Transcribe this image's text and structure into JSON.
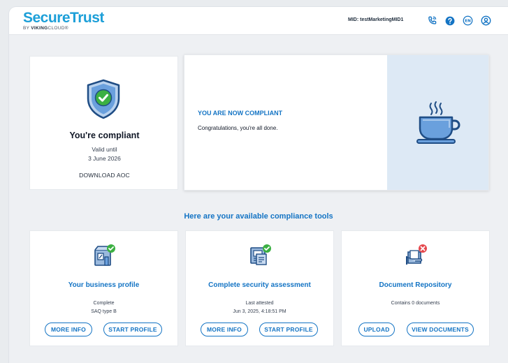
{
  "header": {
    "logo_main": "SecureTrust",
    "logo_by": "BY",
    "logo_brand": "VIKING",
    "logo_brand_suffix": "CLOUD",
    "mid_label": "MID: testMarketingMID1",
    "icons": [
      "phone-icon",
      "help-icon",
      "language-icon",
      "account-icon"
    ],
    "language_code": "EN"
  },
  "compliance": {
    "title": "You're compliant",
    "valid_until": "Valid until",
    "valid_date": "3 June 2026",
    "download_label": "DOWNLOAD AOC"
  },
  "status": {
    "heading": "YOU ARE NOW COMPLIANT",
    "message": "Congratulations, you're all done."
  },
  "tools_title": "Here are your available compliance tools",
  "tools": [
    {
      "title": "Your business profile",
      "line1": "Complete",
      "line2": "SAQ type B",
      "btn1": "MORE INFO",
      "btn2": "START PROFILE",
      "badge": "check"
    },
    {
      "title": "Complete security assessment",
      "line1": "Last attested",
      "line2": "Jun 3, 2025, 4:18:51 PM",
      "btn1": "MORE INFO",
      "btn2": "START PROFILE",
      "badge": "check"
    },
    {
      "title": "Document Repository",
      "line1": "Contains 0 documents",
      "line2": "",
      "btn1": "UPLOAD",
      "btn2": "VIEW DOCUMENTS",
      "badge": "cross"
    }
  ],
  "colors": {
    "brand_blue": "#1474c4",
    "success_green": "#3cb043",
    "error_red": "#e5484d",
    "panel_blue": "#dde9f5"
  }
}
